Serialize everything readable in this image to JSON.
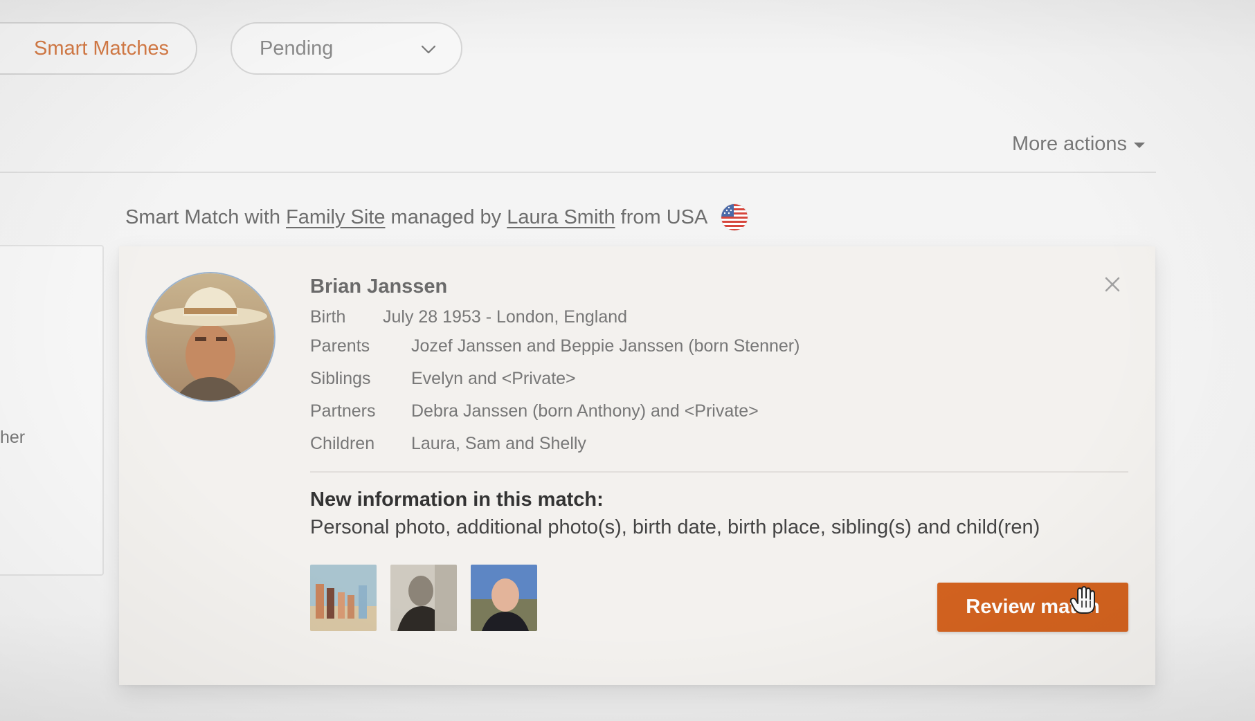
{
  "filters": {
    "smart_matches_label": "Smart Matches",
    "status_select_value": "Pending"
  },
  "toolbar": {
    "more_actions_label": "More actions"
  },
  "match_header": {
    "prefix": "Smart Match with",
    "site_link": "Family Site",
    "middle": "managed by",
    "manager_link": "Laura Smith",
    "suffix": "from USA",
    "flag_icon": "usa-flag-icon"
  },
  "left_panel": {
    "partial_text": "her"
  },
  "person": {
    "name": "Brian Janssen",
    "facts": [
      {
        "label": "Birth",
        "value": "July 28 1953 - London, England"
      },
      {
        "label": "Parents",
        "value": "Jozef Janssen and Beppie Janssen (born Stenner)"
      },
      {
        "label": "Siblings",
        "value": "Evelyn and <Private>"
      },
      {
        "label": "Partners",
        "value": "Debra Janssen (born Anthony) and <Private>"
      },
      {
        "label": "Children",
        "value": "Laura, Sam and Shelly"
      }
    ]
  },
  "new_info": {
    "title": "New information in this match:",
    "text": "Personal photo, additional photo(s), birth date, birth place, sibling(s) and child(ren)"
  },
  "actions": {
    "review_label": "Review match"
  },
  "colors": {
    "accent": "#d2621f",
    "pill_accent_text": "#d47a45",
    "card_bg": "#f3f1ee"
  }
}
